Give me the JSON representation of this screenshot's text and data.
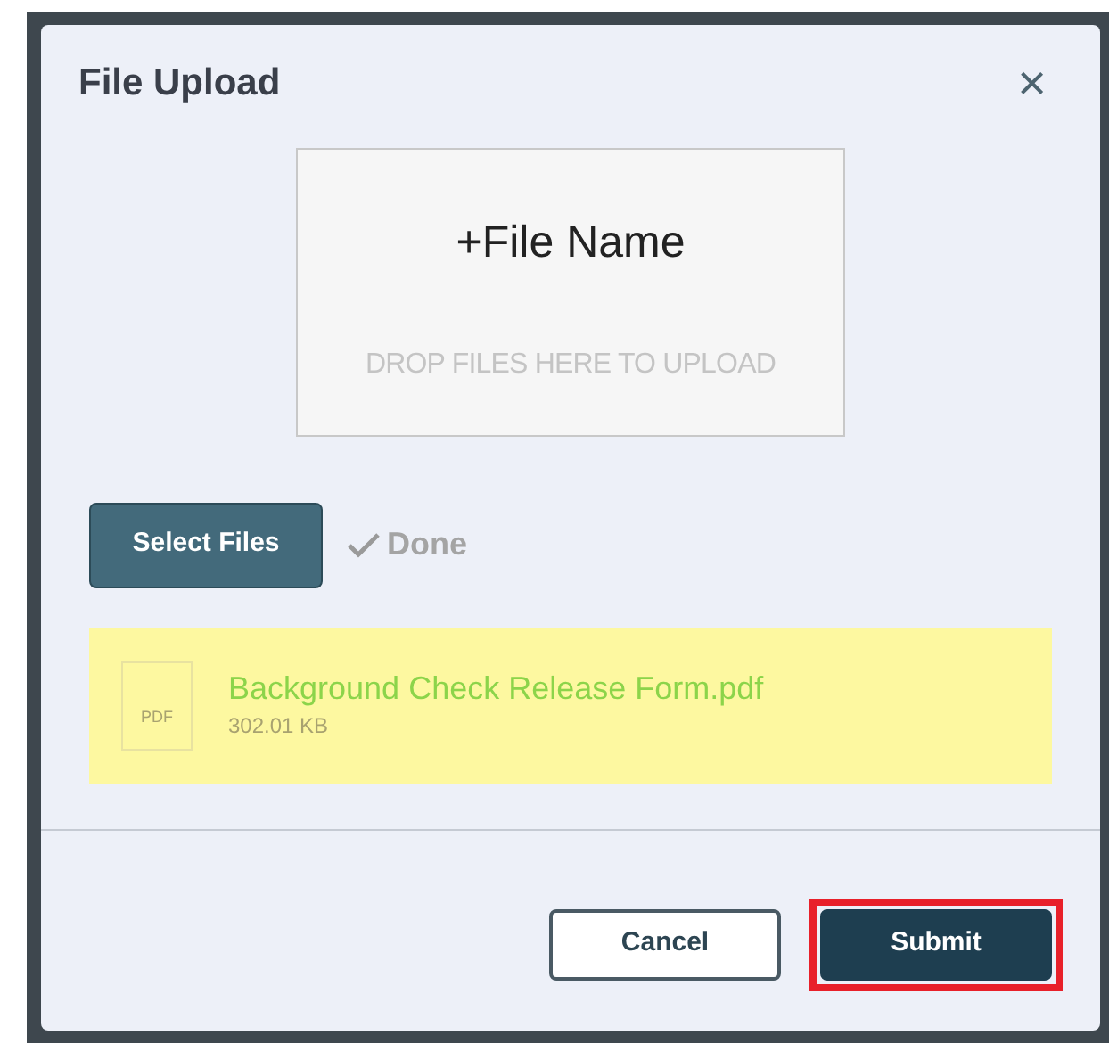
{
  "dialog": {
    "title": "File Upload",
    "close": "×"
  },
  "drop_zone": {
    "title": "+File Name",
    "hint": "DROP FILES HERE TO UPLOAD"
  },
  "select_button": "Select Files",
  "status": {
    "label": "Done",
    "done": true
  },
  "files": [
    {
      "name": "Background Check Release Form.pdf",
      "size": "302.01 KB",
      "icon_label": "PDF",
      "highlighted": true
    }
  ],
  "footer": {
    "buttons": [
      {
        "label": "Cancel",
        "kind": "secondary",
        "highlighted": false
      },
      {
        "label": "Submit",
        "kind": "primary",
        "highlighted": true
      }
    ]
  }
}
